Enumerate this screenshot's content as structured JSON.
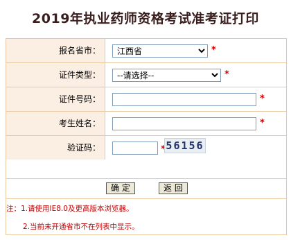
{
  "title": "2019年执业药师资格考试准考证打印",
  "form": {
    "province": {
      "label": "报名省市：",
      "selected": "江西省"
    },
    "id_type": {
      "label": "证件类型：",
      "selected": "--请选择--"
    },
    "id_number": {
      "label": "证件号码：",
      "value": ""
    },
    "name": {
      "label": "考生姓名：",
      "value": ""
    },
    "captcha": {
      "label": "验证码：",
      "value": "",
      "code": "56156"
    },
    "required_mark": "*"
  },
  "buttons": {
    "confirm": "确 定",
    "back": "返 回"
  },
  "notes": {
    "line1": "注：1.请使用IE8.0及更高版本浏览器。",
    "line2": "2.当前未开通省市不在列表中显示。"
  },
  "colors": {
    "label_bg": "#fbeee3",
    "border": "#e7c8a0",
    "required": "#d60000",
    "note_text": "#c00000"
  }
}
